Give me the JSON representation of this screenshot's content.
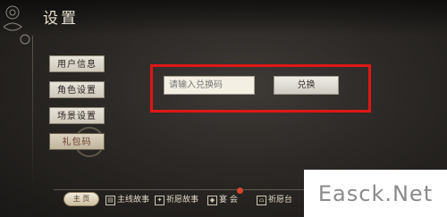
{
  "header": {
    "title": "设置"
  },
  "sidebar": {
    "items": [
      {
        "label": "用户信息"
      },
      {
        "label": "角色设置"
      },
      {
        "label": "场景设置"
      },
      {
        "label": "礼包码",
        "active": true
      }
    ]
  },
  "redeem": {
    "placeholder": "请输入兑换码",
    "button_label": "兑换",
    "highlight_color": "#e01717"
  },
  "bottom_bar": {
    "home_label": "主 页",
    "items": [
      {
        "icon": "book-icon",
        "label": "主线故事"
      },
      {
        "icon": "scroll-icon",
        "label": "祈愿故事"
      },
      {
        "icon": "gathering-icon",
        "label": "宴 会"
      },
      {
        "icon": "shrine-icon",
        "label": "祈愿台"
      }
    ],
    "notification_color": "#d8452a"
  },
  "watermark": {
    "text": "Easck.Net"
  }
}
